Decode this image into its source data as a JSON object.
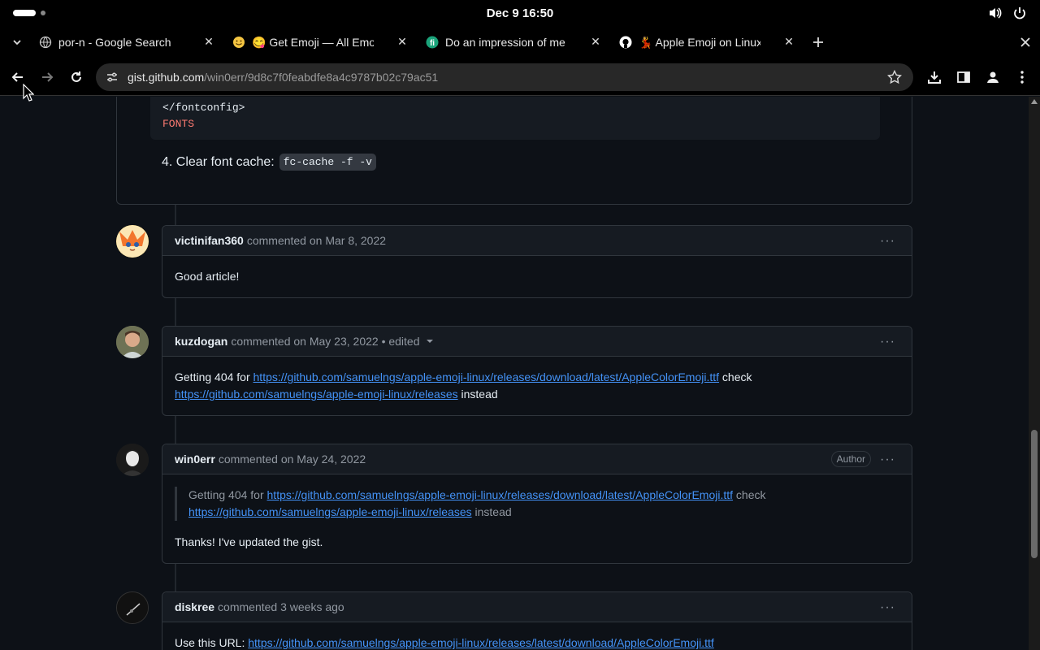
{
  "system": {
    "clock": "Dec 9  16:50"
  },
  "tabs": [
    {
      "title": "por-n - Google Search",
      "favicon": "globe-icon"
    },
    {
      "title": "😋 Get Emoji — All Emoji",
      "favicon": "emoji-icon"
    },
    {
      "title": "Do an impression of me a",
      "favicon": "f-icon"
    },
    {
      "title": "💃 Apple Emoji on Linux",
      "favicon": "github-icon"
    }
  ],
  "toolbar": {
    "url_host": "gist.github.com",
    "url_path": "/win0err/9d8c7f0feabdfe8a4c9787b02c79ac51"
  },
  "code": {
    "line1": "</fontconfig>",
    "line2": "FONTS"
  },
  "step": {
    "text": "4. Clear font cache:",
    "code": "fc-cache -f -v"
  },
  "comments": [
    {
      "user": "victinifan360",
      "meta": "commented on Mar 8, 2022",
      "body": "Good article!"
    },
    {
      "user": "kuzdogan",
      "meta": "commented on May 23, 2022 • edited",
      "body_pre": "Getting 404 for ",
      "link1": "https://github.com/samuelngs/apple-emoji-linux/releases/download/latest/AppleColorEmoji.ttf",
      "body_mid": " check",
      "link2": "https://github.com/samuelngs/apple-emoji-linux/releases",
      "body_post": " instead"
    },
    {
      "user": "win0err",
      "meta": "commented on May 24, 2022",
      "badge": "Author",
      "quote_pre": "Getting 404 for ",
      "link1": "https://github.com/samuelngs/apple-emoji-linux/releases/download/latest/AppleColorEmoji.ttf",
      "quote_mid": " check",
      "link2": "https://github.com/samuelngs/apple-emoji-linux/releases",
      "quote_post": " instead",
      "body": "Thanks! I've updated the gist."
    },
    {
      "user": "diskree",
      "meta": "commented 3 weeks ago",
      "body_pre": "Use this URL: ",
      "link1": "https://github.com/samuelngs/apple-emoji-linux/releases/latest/download/AppleColorEmoji.ttf"
    }
  ],
  "more_label": "···"
}
